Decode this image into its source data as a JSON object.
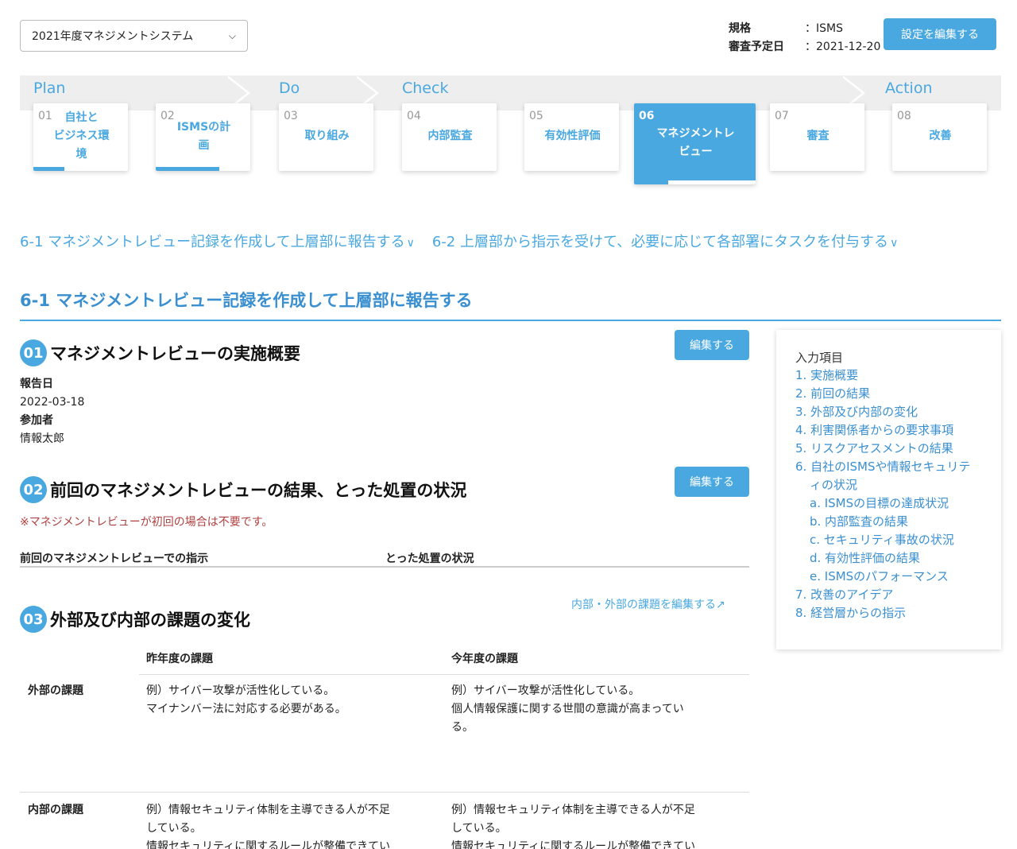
{
  "system_select": {
    "value": "2021年度マネジメントシステム"
  },
  "meta": {
    "standard_label": "規格",
    "standard_value": "：ISMS",
    "audit_label": "審査予定日",
    "audit_value": "：2021-12-20"
  },
  "edit_settings_label": "設定を編集する",
  "phases": [
    "Plan",
    "Do",
    "Check",
    "Action"
  ],
  "steps": [
    {
      "num": "01",
      "label": "自社と\nビジネス環\n境",
      "progress": 0.33
    },
    {
      "num": "02",
      "label": "ISMSの計\n画",
      "progress": 0.67
    },
    {
      "num": "03",
      "label": "取り組み",
      "progress": 0
    },
    {
      "num": "04",
      "label": "内部監査",
      "progress": 0
    },
    {
      "num": "05",
      "label": "有効性評価",
      "progress": 0
    },
    {
      "num": "06",
      "label": "マネジメントレ\nビュー",
      "progress": 0.28
    },
    {
      "num": "07",
      "label": "審査",
      "progress": 0
    },
    {
      "num": "08",
      "label": "改善",
      "progress": 0
    }
  ],
  "anchors": [
    "6-1 マネジメントレビュー記録を作成して上層部に報告する",
    "6-2 上層部から指示を受けて、必要に応じて各部署にタスクを付与する"
  ],
  "section_title": "6-1 マネジメントレビュー記録を作成して上層部に報告する",
  "s1": {
    "badge": "01",
    "title": "マネジメントレビューの実施概要",
    "edit": "編集する",
    "report_date_label": "報告日",
    "report_date": "2022-03-18",
    "participants_label": "参加者",
    "participants": "情報太郎"
  },
  "s2": {
    "badge": "02",
    "title": "前回のマネジメントレビューの結果、とった処置の状況",
    "edit": "編集する",
    "note": "※マネジメントレビューが初回の場合は不要です。",
    "col1": "前回のマネジメントレビューでの指示",
    "col2": "とった処置の状況"
  },
  "s3": {
    "badge": "03",
    "title": "外部及び内部の課題の変化",
    "link": "内部・外部の課題を編集する",
    "col_prev": "昨年度の課題",
    "col_curr": "今年度の課題",
    "rows": [
      {
        "label": "外部の課題",
        "prev": "例）サイバー攻撃が活性化している。\nマイナンバー法に対応する必要がある。",
        "curr": "例）サイバー攻撃が活性化している。\n個人情報保護に関する世間の意識が高まってい\nる。"
      },
      {
        "label": "内部の課題",
        "prev": "例）情報セキュリティ体制を主導できる人が不足\nしている。\n情報セキュリティに関するルールが整備できてい",
        "curr": "例）情報セキュリティ体制を主導できる人が不足\nしている。\n情報セキュリティに関するルールが整備できてい"
      }
    ]
  },
  "side": {
    "title": "入力項目",
    "items": [
      {
        "text": "1. 実施概要",
        "sub": false
      },
      {
        "text": "2. 前回の結果",
        "sub": false
      },
      {
        "text": "3. 外部及び内部の変化",
        "sub": false
      },
      {
        "text": "4. 利害関係者からの要求事項",
        "sub": false
      },
      {
        "text": "5. リスクアセスメントの結果",
        "sub": false
      },
      {
        "text": "6. 自社のISMSや情報セキュリテ",
        "sub": false
      },
      {
        "text": "ィの状況",
        "sub": true
      },
      {
        "text": "a. ISMSの目標の達成状況",
        "sub": true
      },
      {
        "text": "b. 内部監査の結果",
        "sub": true
      },
      {
        "text": "c. セキュリティ事故の状況",
        "sub": true
      },
      {
        "text": "d. 有効性評価の結果",
        "sub": true
      },
      {
        "text": "e. ISMSのパフォーマンス",
        "sub": true
      },
      {
        "text": "7. 改善のアイデア",
        "sub": false
      },
      {
        "text": "8. 経営層からの指示",
        "sub": false
      }
    ]
  }
}
